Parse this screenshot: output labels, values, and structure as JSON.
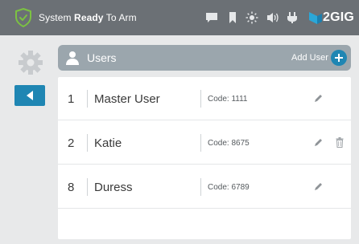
{
  "statusbar": {
    "status_prefix": "System ",
    "status_bold": "Ready",
    "status_suffix": " To Arm",
    "brand": "2GIG",
    "icons": [
      "shield-check-icon",
      "message-icon",
      "bookmark-icon",
      "sun-icon",
      "volume-icon",
      "plug-icon"
    ]
  },
  "sidebar": {
    "icons": [
      "gear-icon",
      "back-arrow-icon"
    ]
  },
  "header": {
    "title": "Users",
    "add_user_label": "Add User"
  },
  "users": [
    {
      "number": "1",
      "name": "Master User",
      "code": "Code: 1111",
      "deletable": false
    },
    {
      "number": "2",
      "name": "Katie",
      "code": "Code: 8675",
      "deletable": true
    },
    {
      "number": "8",
      "name": "Duress",
      "code": "Code: 6789",
      "deletable": false
    }
  ],
  "colors": {
    "statusbar": "#6b7075",
    "accent_blue": "#1f86b3",
    "header_bar": "#9ba6ad",
    "shield_green": "#7cc242",
    "background": "#e8e9ea"
  }
}
